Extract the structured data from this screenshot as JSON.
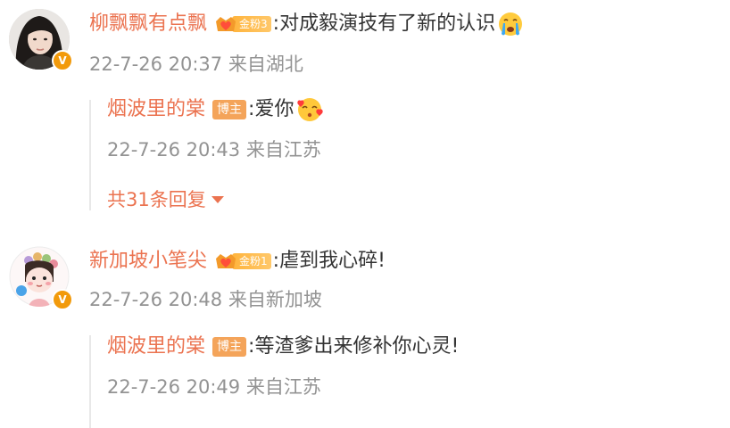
{
  "comments": [
    {
      "username": "柳飘飘有点飘",
      "fan_badge": "金粉3",
      "separator": ":",
      "text": "对成毅演技有了新的认识",
      "emoji_icon": "crying-face-icon",
      "time": "22-7-26 20:37",
      "location": "来自湖北",
      "verified_mark": "V",
      "reply": {
        "username": "烟波里的棠",
        "tag": "博主",
        "separator": ":",
        "text": "爱你",
        "emoji_icon": "heart-kiss-face-icon",
        "time": "22-7-26 20:43",
        "location": "来自江苏"
      },
      "more_replies": "共31条回复"
    },
    {
      "username": "新加坡小笔尖",
      "fan_badge": "金粉1",
      "separator": ":",
      "text": "虐到我心碎!",
      "time": "22-7-26 20:48",
      "location": "来自新加坡",
      "verified_mark": "V",
      "reply": {
        "username": "烟波里的棠",
        "tag": "博主",
        "separator": ":",
        "text": "等渣爹出来修补你心灵!",
        "time": "22-7-26 20:49",
        "location": "来自江苏"
      }
    }
  ],
  "colors": {
    "username": "#eb7350",
    "meta": "#939393",
    "text": "#333333",
    "fan_badge": "#ffb43c",
    "blogger_tag": "#f4a45a",
    "verified": "#f29a0b"
  }
}
